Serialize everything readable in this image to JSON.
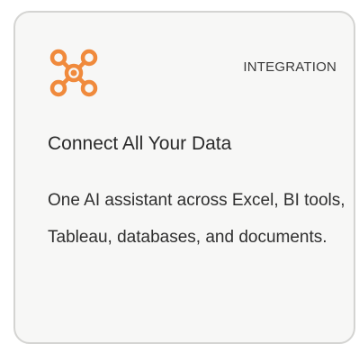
{
  "card": {
    "icon": "integration-hub-icon",
    "accent_color": "#f08a3c",
    "badge": "INTEGRATION",
    "title": "Connect All Your Data",
    "description": "One AI assistant across Excel, BI tools, Tableau, databases, and documents."
  }
}
